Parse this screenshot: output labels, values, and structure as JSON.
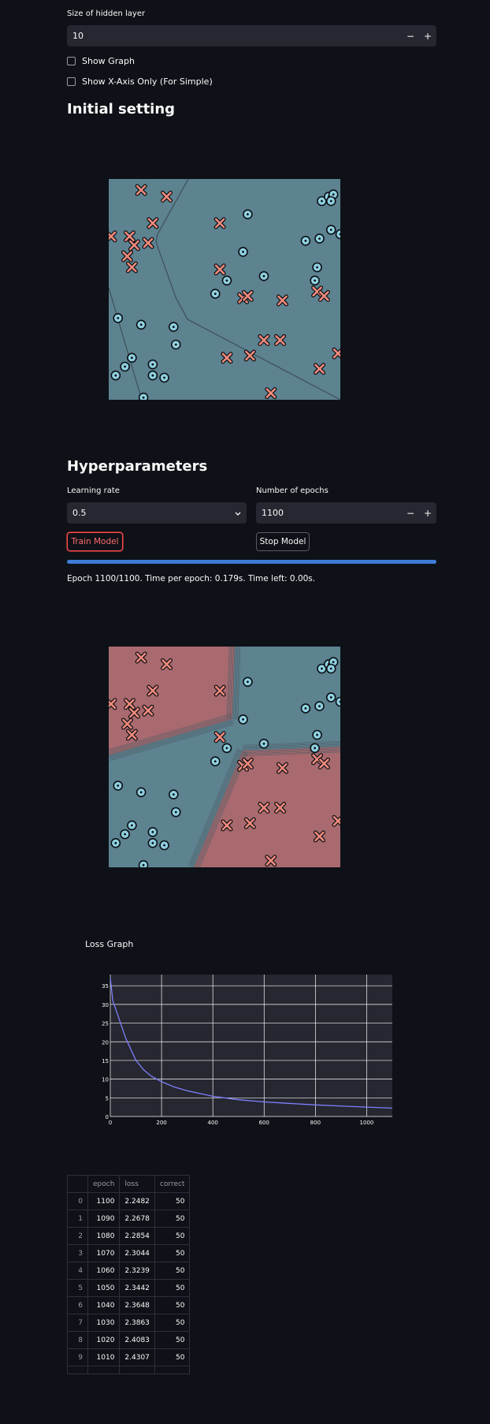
{
  "hidden_layer": {
    "label": "Size of hidden layer",
    "value": "10",
    "minus": "−",
    "plus": "+"
  },
  "checkboxes": {
    "show_graph": "Show Graph",
    "show_x_axis": "Show X-Axis Only (For Simple)"
  },
  "sections": {
    "initial": "Initial setting",
    "hyper": "Hyperparameters"
  },
  "learning_rate": {
    "label": "Learning rate",
    "value": "0.5"
  },
  "epochs": {
    "label": "Number of epochs",
    "value": "1100",
    "minus": "−",
    "plus": "+"
  },
  "buttons": {
    "train": "Train Model",
    "stop": "Stop Model"
  },
  "progress": {
    "fraction": 1.0
  },
  "status": "Epoch 1100/1100. Time per epoch: 0.179s. Time left: 0.00s.",
  "colors": {
    "accent": "#ff4b4b",
    "progress": "#3e7bd6",
    "blue_region": "#5d8290",
    "red_region": "#a86a6f",
    "line": "#7f7fff"
  },
  "scatter_points": {
    "cross": [
      [
        14,
        5
      ],
      [
        25,
        8
      ],
      [
        19,
        20
      ],
      [
        48,
        20
      ],
      [
        1,
        26
      ],
      [
        9,
        26
      ],
      [
        11,
        30
      ],
      [
        17,
        29
      ],
      [
        8,
        35
      ],
      [
        10,
        40
      ],
      [
        48,
        41
      ],
      [
        58,
        54
      ],
      [
        60,
        53
      ],
      [
        75,
        55
      ],
      [
        90,
        51
      ],
      [
        93,
        53
      ],
      [
        67,
        73
      ],
      [
        74,
        73
      ],
      [
        99,
        79
      ],
      [
        51,
        81
      ],
      [
        61,
        80
      ],
      [
        91,
        86
      ],
      [
        70,
        97
      ]
    ],
    "circle": [
      [
        92,
        10
      ],
      [
        95,
        8
      ],
      [
        97,
        7
      ],
      [
        96,
        10
      ],
      [
        60,
        16
      ],
      [
        100,
        25
      ],
      [
        91,
        27
      ],
      [
        85,
        28
      ],
      [
        96,
        23
      ],
      [
        58,
        33
      ],
      [
        67,
        44
      ],
      [
        90,
        40
      ],
      [
        89,
        46
      ],
      [
        51,
        46
      ],
      [
        46,
        52
      ],
      [
        4,
        63
      ],
      [
        14,
        66
      ],
      [
        28,
        67
      ],
      [
        29,
        75
      ],
      [
        10,
        81
      ],
      [
        7,
        85
      ],
      [
        3,
        89
      ],
      [
        19,
        84
      ],
      [
        19,
        89
      ],
      [
        24,
        90
      ],
      [
        15,
        99
      ]
    ]
  },
  "loss_graph": {
    "title": "Loss Graph"
  },
  "chart_data": {
    "type": "line",
    "title": "",
    "xlabel": "",
    "ylabel": "",
    "xlim": [
      0,
      1100
    ],
    "ylim": [
      0,
      38
    ],
    "xticks": [
      0,
      200,
      400,
      600,
      800,
      1000
    ],
    "yticks": [
      0,
      5,
      10,
      15,
      20,
      25,
      30,
      35
    ],
    "grid": true,
    "series": [
      {
        "x": [
          0,
          10,
          30,
          60,
          100,
          130,
          160,
          200,
          250,
          300,
          400,
          500,
          600,
          700,
          800,
          900,
          1000,
          1100
        ],
        "values": [
          37,
          31,
          27,
          21,
          15,
          12.5,
          10.8,
          9.3,
          7.9,
          6.9,
          5.4,
          4.5,
          3.9,
          3.5,
          3.1,
          2.8,
          2.5,
          2.25
        ]
      }
    ]
  },
  "table": {
    "columns": [
      "",
      "epoch",
      "loss",
      "correct"
    ],
    "rows": [
      [
        "0",
        "1100",
        "2.2482",
        "50"
      ],
      [
        "1",
        "1090",
        "2.2678",
        "50"
      ],
      [
        "2",
        "1080",
        "2.2854",
        "50"
      ],
      [
        "3",
        "1070",
        "2.3044",
        "50"
      ],
      [
        "4",
        "1060",
        "2.3239",
        "50"
      ],
      [
        "5",
        "1050",
        "2.3442",
        "50"
      ],
      [
        "6",
        "1040",
        "2.3648",
        "50"
      ],
      [
        "7",
        "1030",
        "2.3863",
        "50"
      ],
      [
        "8",
        "1020",
        "2.4083",
        "50"
      ],
      [
        "9",
        "1010",
        "2.4307",
        "50"
      ],
      [
        "",
        "",
        "",
        ""
      ]
    ]
  }
}
